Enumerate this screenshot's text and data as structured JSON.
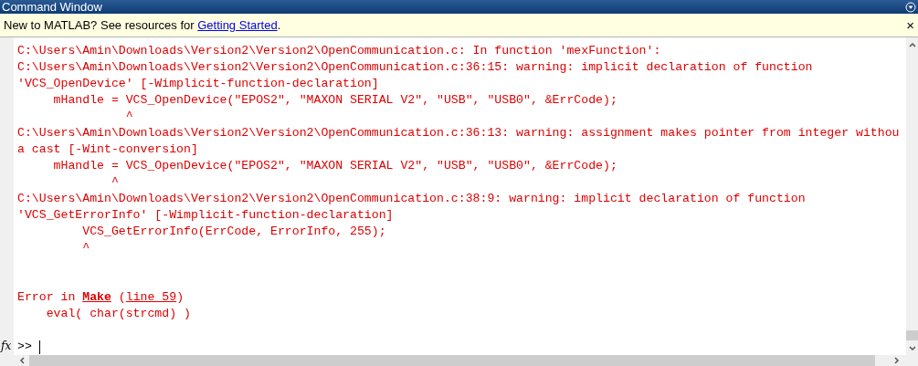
{
  "window": {
    "title": "Command Window"
  },
  "info_bar": {
    "before": "New to MATLAB? See resources for ",
    "link": "Getting Started",
    "after": ".",
    "close": "×"
  },
  "output": [
    {
      "kind": "text",
      "text": "C:\\Users\\Amin\\Downloads\\Version2\\Version2\\OpenCommunication.c: In function 'mexFunction':"
    },
    {
      "kind": "text",
      "text": "C:\\Users\\Amin\\Downloads\\Version2\\Version2\\OpenCommunication.c:36:15: warning: implicit declaration of function"
    },
    {
      "kind": "text",
      "text": "'VCS_OpenDevice' [-Wimplicit-function-declaration]"
    },
    {
      "kind": "text",
      "text": "     mHandle = VCS_OpenDevice(\"EPOS2\", \"MAXON SERIAL V2\", \"USB\", \"USB0\", &ErrCode);"
    },
    {
      "kind": "text",
      "text": "               ^"
    },
    {
      "kind": "text",
      "text": "C:\\Users\\Amin\\Downloads\\Version2\\Version2\\OpenCommunication.c:36:13: warning: assignment makes pointer from integer withou"
    },
    {
      "kind": "text",
      "text": "a cast [-Wint-conversion]"
    },
    {
      "kind": "text",
      "text": "     mHandle = VCS_OpenDevice(\"EPOS2\", \"MAXON SERIAL V2\", \"USB\", \"USB0\", &ErrCode);"
    },
    {
      "kind": "text",
      "text": "             ^"
    },
    {
      "kind": "text",
      "text": "C:\\Users\\Amin\\Downloads\\Version2\\Version2\\OpenCommunication.c:38:9: warning: implicit declaration of function"
    },
    {
      "kind": "text",
      "text": "'VCS_GetErrorInfo' [-Wimplicit-function-declaration]"
    },
    {
      "kind": "text",
      "text": "         VCS_GetErrorInfo(ErrCode, ErrorInfo, 255);"
    },
    {
      "kind": "text",
      "text": "         ^"
    },
    {
      "kind": "blank"
    },
    {
      "kind": "blank"
    },
    {
      "kind": "parts",
      "parts": [
        {
          "text": "Error in ",
          "link": false,
          "bold": false
        },
        {
          "text": "Make",
          "link": true,
          "bold": true
        },
        {
          "text": " (",
          "link": false,
          "bold": false
        },
        {
          "text": "line 59",
          "link": true,
          "bold": false
        },
        {
          "text": ")",
          "link": false,
          "bold": false
        }
      ]
    },
    {
      "kind": "text",
      "text": "    eval( char(strcmd) )"
    },
    {
      "kind": "blank"
    }
  ],
  "prompt": {
    "fx": "fx",
    "symbol": ">>"
  }
}
